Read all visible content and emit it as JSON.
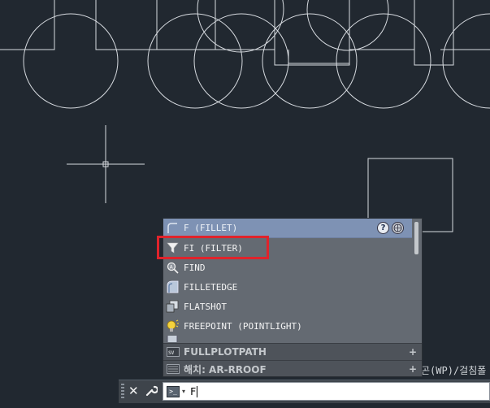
{
  "canvas": {
    "background": "#212830",
    "line_color": "#d7dbe0"
  },
  "command_hint": "곤(WP)/걸침폴",
  "popup": {
    "header": {
      "label": "F (FILLET)",
      "icon": "fillet-icon"
    },
    "header_buttons": [
      {
        "label": "?",
        "icon": "help-icon"
      },
      {
        "label": "",
        "icon": "internet-search-icon"
      }
    ],
    "items": [
      {
        "label": "FI (FILTER)",
        "icon": "funnel-filter-icon"
      },
      {
        "label": "FIND",
        "icon": "find-magnifier-icon"
      },
      {
        "label": "FILLETEDGE",
        "icon": "filletedge-icon"
      },
      {
        "label": "FLATSHOT",
        "icon": "flatshot-icon"
      },
      {
        "label": "FREEPOINT (POINTLIGHT)",
        "icon": "point-light-bulb-icon"
      }
    ],
    "sections": [
      {
        "label": "FULLPLOTPATH",
        "icon": "system-variable-icon",
        "expand": "+"
      },
      {
        "label": "해치: AR-RROOF",
        "icon": "hatch-pattern-icon",
        "expand": "+"
      }
    ]
  },
  "command_line": {
    "close_label": "✕",
    "prompt_glyph": ">_",
    "prompt_caret": "▾",
    "input_value": "F"
  },
  "colors": {
    "highlight_box": "#e0232b",
    "popup_header": "#7e92b4"
  }
}
